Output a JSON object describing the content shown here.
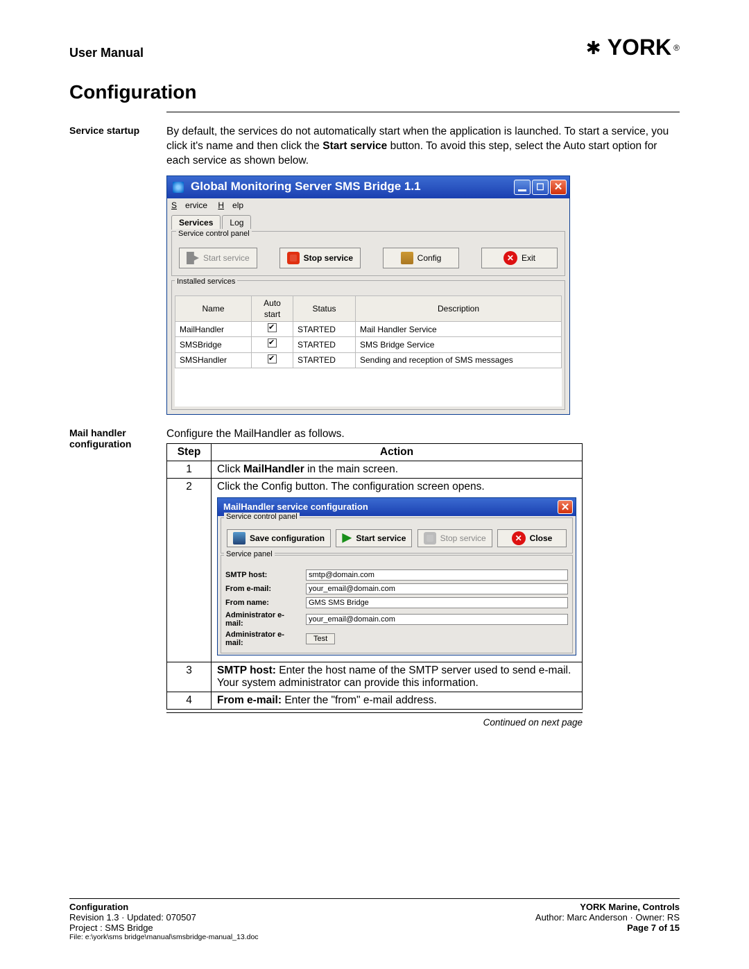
{
  "header": {
    "left": "User Manual",
    "logo_text": "YORK"
  },
  "title": "Configuration",
  "section1": {
    "label": "Service startup",
    "para_before": "By default, the services do not automatically start when the application is launched. To start a service, you click it's name and then click the ",
    "para_bold": "Start service",
    "para_after": " button. To avoid this step, select the Auto start option for each service as shown below."
  },
  "win1": {
    "title": "Global Monitoring Server SMS Bridge 1.1",
    "menu_service": "Service",
    "menu_help": "Help",
    "tab_services": "Services",
    "tab_log": "Log",
    "panel_legend": "Service control panel",
    "btn_start": "Start service",
    "btn_stop": "Stop service",
    "btn_config": "Config",
    "btn_exit": "Exit",
    "installed_legend": "Installed services",
    "cols": {
      "name": "Name",
      "auto": "Auto start",
      "status": "Status",
      "desc": "Description"
    },
    "rows": [
      {
        "name": "MailHandler",
        "status": "STARTED",
        "desc": "Mail Handler Service"
      },
      {
        "name": "SMSBridge",
        "status": "STARTED",
        "desc": "SMS Bridge Service"
      },
      {
        "name": "SMSHandler",
        "status": "STARTED",
        "desc": "Sending and reception of SMS messages"
      }
    ]
  },
  "section2": {
    "label": "Mail handler configuration",
    "text": "Configure the MailHandler as follows."
  },
  "steps": {
    "hdr_step": "Step",
    "hdr_action": "Action",
    "r1_num": "1",
    "r1_pre": "Click ",
    "r1_bold": "MailHandler",
    "r1_post": " in the main screen.",
    "r2_num": "2",
    "r2_text": "Click the Config button. The configuration screen opens.",
    "r3_num": "3",
    "r3_b": "SMTP host:",
    "r3_text": " Enter the host name of the SMTP server used to send e-mail. Your system administrator can provide this information.",
    "r4_num": "4",
    "r4_b": "From e-mail:",
    "r4_text": " Enter the \"from\" e-mail address."
  },
  "dlg": {
    "title": "MailHandler service configuration",
    "legend_scp": "Service control panel",
    "btn_save": "Save configuration",
    "btn_start": "Start service",
    "btn_stop": "Stop service",
    "btn_close": "Close",
    "legend_sp": "Service panel",
    "lbl_smtp": "SMTP host:",
    "val_smtp": "smtp@domain.com",
    "lbl_from": "From e-mail:",
    "val_from": "your_email@domain.com",
    "lbl_name": "From name:",
    "val_name": "GMS SMS Bridge",
    "lbl_admin": "Administrator e-mail:",
    "val_admin": "your_email@domain.com",
    "lbl_admin2": "Administrator e-mail:",
    "btn_test": "Test"
  },
  "continued": "Continued on next page",
  "footer": {
    "left1": "Configuration",
    "right1": "YORK Marine, Controls",
    "left2": "Revision 1.3  ·  Updated: 070507",
    "right2": "Author: Marc Anderson  ·  Owner: RS",
    "left3": "Project : SMS Bridge",
    "right3": "Page 7 of 15",
    "file": "File: e:\\york\\sms bridge\\manual\\smsbridge-manual_13.doc"
  }
}
